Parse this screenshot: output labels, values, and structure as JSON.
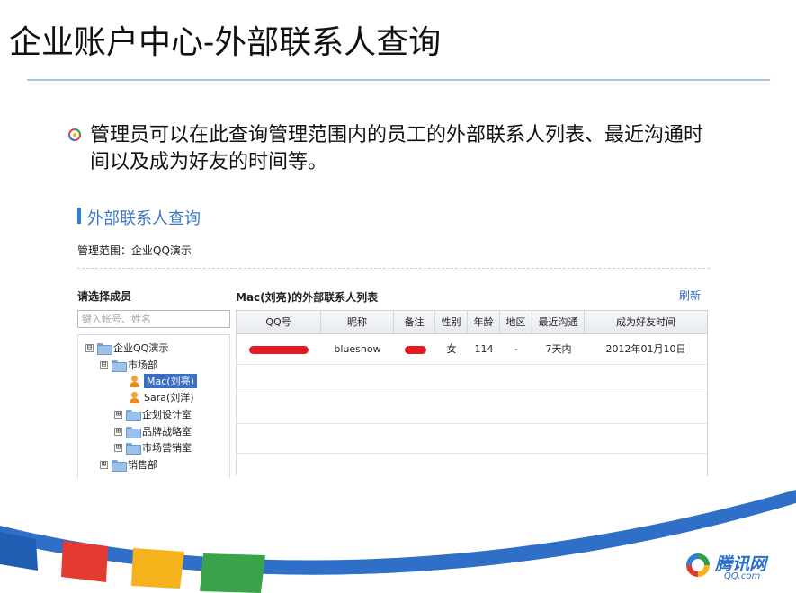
{
  "slide": {
    "title": "企业账户中心-外部联系人查询",
    "bullet": "管理员可以在此查询管理范围内的员工的外部联系人列表、最近沟通时间以及成为好友的时间等。"
  },
  "panel": {
    "title": "外部联系人查询",
    "scope": "管理范围：企业QQ演示"
  },
  "left": {
    "label": "请选择成员",
    "search_placeholder": "键入帐号、姓名",
    "tree": {
      "root": "企业QQ演示",
      "dept_market": "市场部",
      "member_mac": "Mac(刘亮)",
      "member_sara": "Sara(刘洋)",
      "sub_plan": "企划设计室",
      "sub_brand": "品牌战略室",
      "sub_sales_market": "市场营销室",
      "dept_sales": "销售部",
      "expand_minus": "⊟",
      "expand_plus": "⊞"
    }
  },
  "list": {
    "title": "Mac(刘亮)的外部联系人列表",
    "refresh": "刷新",
    "columns": [
      "QQ号",
      "昵称",
      "备注",
      "性别",
      "年龄",
      "地区",
      "最近沟通",
      "成为好友时间"
    ],
    "rows": [
      {
        "qq": "",
        "nickname": "bluesnow",
        "remark": "",
        "gender": "女",
        "age": "114",
        "region": "-",
        "last_contact": "7天内",
        "friend_since": "2012年01月10日"
      }
    ]
  },
  "logo": {
    "cn": "腾讯网",
    "en": "QQ.com",
    "icon": "tencent-logo-icon"
  },
  "colors": {
    "accent": "#3a78c4",
    "selected": "#3a6fc7",
    "redaction": "#e31b23"
  }
}
